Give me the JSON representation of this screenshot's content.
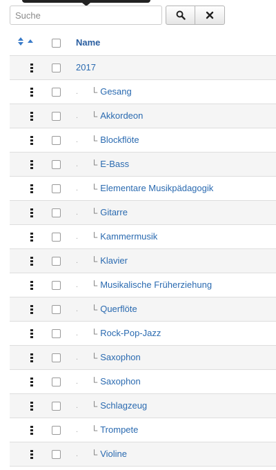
{
  "search": {
    "placeholder": "Suche",
    "value": ""
  },
  "table": {
    "name_header": "Name",
    "root": {
      "label": "2017"
    },
    "tree_prefix": "└",
    "indent_marker": ".",
    "items": [
      "Gesang",
      "Akkordeon",
      "Blockflöte",
      "E-Bass",
      "Elementare Musikpädagogik",
      "Gitarre",
      "Kammermusik",
      "Klavier",
      "Musikalische Früherziehung",
      "Querflöte",
      "Rock-Pop-Jazz",
      "Saxophon",
      "Saxophon",
      "Schlagzeug",
      "Trompete",
      "Violine"
    ]
  },
  "colors": {
    "link": "#2a6ab0",
    "header_link": "#2a5ea0",
    "sort_icon": "#3a7bc8"
  }
}
